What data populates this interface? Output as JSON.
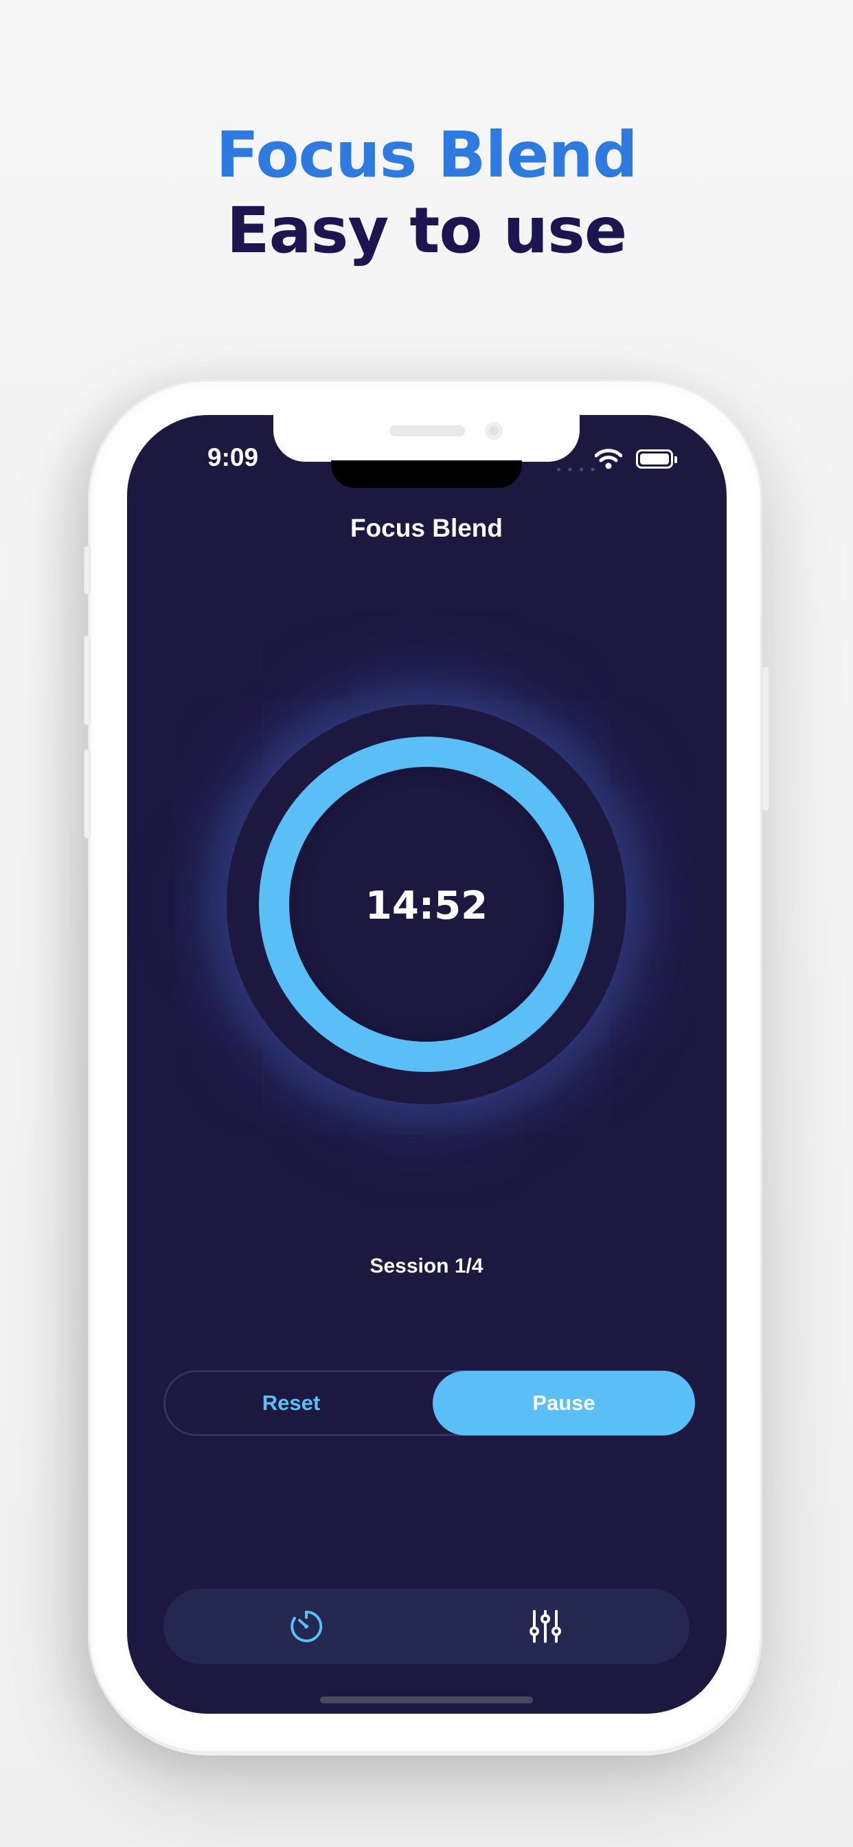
{
  "headline": {
    "line1": "Focus Blend",
    "line2": "Easy to use"
  },
  "status_bar": {
    "time": "9:09",
    "signal_icon": "signal-dots-icon",
    "wifi_icon": "wifi-icon",
    "battery_icon": "battery-icon",
    "battery_level": 1.0
  },
  "app": {
    "title": "Focus Blend",
    "timer": {
      "value": "14:52",
      "ring_color": "#5abff7"
    },
    "session": "Session 1/4",
    "controls": {
      "reset_label": "Reset",
      "pause_label": "Pause",
      "selected": "Pause"
    },
    "tabs": [
      {
        "icon": "timer-icon",
        "active": true
      },
      {
        "icon": "sliders-icon",
        "active": false
      }
    ]
  },
  "colors": {
    "accent": "#5abff7",
    "screen_background": "#1d1840",
    "headline_blue": "#2d7be0",
    "headline_navy": "#1c1550"
  }
}
